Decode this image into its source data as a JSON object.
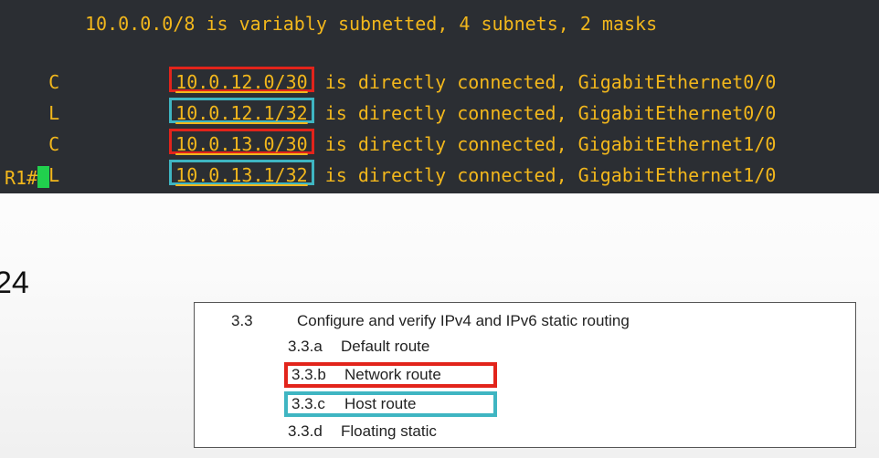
{
  "terminal": {
    "header": "10.0.0.0/8 is variably subnetted, 4 subnets, 2 masks",
    "routes": [
      {
        "code": "C",
        "network": "10.0.12.0/30",
        "text": " is directly connected, GigabitEthernet0/0",
        "highlight": "red"
      },
      {
        "code": "L",
        "network": "10.0.12.1/32",
        "text": " is directly connected, GigabitEthernet0/0",
        "highlight": "cyan"
      },
      {
        "code": "C",
        "network": "10.0.13.0/30",
        "text": " is directly connected, GigabitEthernet1/0",
        "highlight": "red"
      },
      {
        "code": "L",
        "network": "10.0.13.1/32",
        "text": " is directly connected, GigabitEthernet1/0",
        "highlight": "cyan"
      }
    ],
    "prompt": "R1#"
  },
  "side_label": "24",
  "blueprint": {
    "section_number": "3.3",
    "section_title": "Configure and verify IPv4 and IPv6 static routing",
    "items": [
      {
        "number": "3.3.a",
        "label": "Default route"
      },
      {
        "number": "3.3.b",
        "label": "Network route",
        "highlight": "red"
      },
      {
        "number": "3.3.c",
        "label": "Host route",
        "highlight": "cyan"
      },
      {
        "number": "3.3.d",
        "label": "Floating static"
      }
    ]
  },
  "colors": {
    "terminal_bg": "#2b2e33",
    "terminal_text": "#f2b71c",
    "cursor": "#21d04d",
    "highlight_red": "#e2241b",
    "highlight_cyan": "#3fb5c2"
  }
}
